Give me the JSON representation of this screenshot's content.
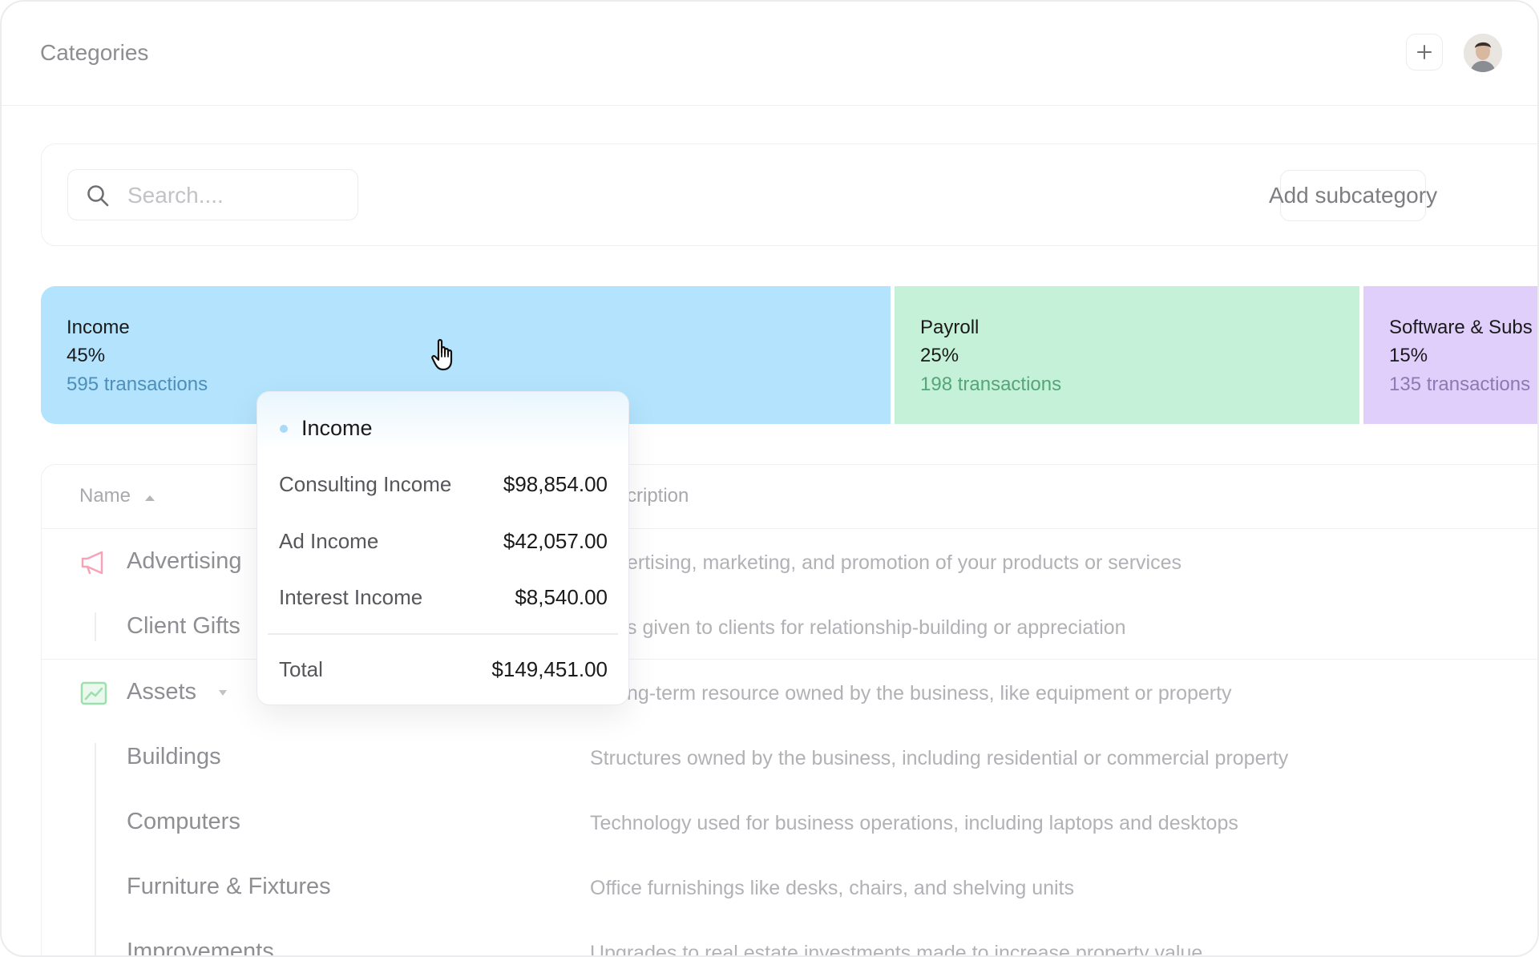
{
  "header": {
    "title": "Categories"
  },
  "search": {
    "placeholder": "Search....",
    "add_button": "Add subcategory"
  },
  "categories": [
    {
      "name": "Income",
      "percent": "45%",
      "transactions": "595 transactions",
      "color": "#b3e3fd",
      "text_color": "#4d8fba"
    },
    {
      "name": "Payroll",
      "percent": "25%",
      "transactions": "198 transactions",
      "color": "#c4f1d7",
      "text_color": "#55a57a"
    },
    {
      "name": "Software & Subs",
      "percent": "15%",
      "transactions": "135 transactions",
      "color": "#e0cffb",
      "text_color": "#8f78b3"
    }
  ],
  "table": {
    "columns": {
      "name": "Name",
      "description": "cription"
    },
    "rows": [
      {
        "name": "Advertising",
        "description": "ertising, marketing, and promotion of your products or services"
      },
      {
        "name": "Client Gifts",
        "description": "s given to clients for relationship-building or appreciation"
      },
      {
        "name": "Assets",
        "description": "ng-term resource owned by the business, like equipment or property"
      },
      {
        "name": "Buildings",
        "description": "Structures owned by the business, including residential or commercial property"
      },
      {
        "name": "Computers",
        "description": "Technology used for business operations, including laptops and desktops"
      },
      {
        "name": "Furniture & Fixtures",
        "description": "Office furnishings like desks, chairs, and shelving units"
      },
      {
        "name": "Improvements",
        "description": "Upgrades to real estate investments made to increase property value"
      }
    ]
  },
  "tooltip": {
    "title": "Income",
    "items": [
      {
        "label": "Consulting Income",
        "value": "$98,854.00"
      },
      {
        "label": "Ad Income",
        "value": "$42,057.00"
      },
      {
        "label": "Interest Income",
        "value": "$8,540.00"
      }
    ],
    "total": {
      "label": "Total",
      "value": "$149,451.00"
    }
  },
  "icons": {
    "plus": "plus-icon",
    "search": "search-icon",
    "advertising": "megaphone-icon",
    "assets": "chart-line-icon",
    "sort": "sort-up-icon",
    "expand": "caret-down-icon",
    "cursor": "hand-pointer-icon"
  },
  "colors": {
    "advertising_icon": "#f6a3b8",
    "assets_icon": "#9ddfad"
  }
}
